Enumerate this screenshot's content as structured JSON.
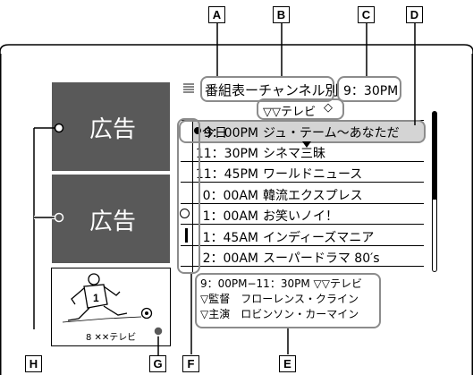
{
  "callouts": {
    "a": "A",
    "b": "B",
    "c": "C",
    "d": "D",
    "e": "E",
    "f": "F",
    "g": "G",
    "h": "H"
  },
  "header": {
    "title": "番組表ーチャンネル別",
    "time": "9：30PM",
    "channel": "▽▽テレビ",
    "channel_arrow": "◇"
  },
  "ads": {
    "top": "広告",
    "middle": "広告"
  },
  "thumbnail": {
    "channel_label": "8 ✕✕テレビ"
  },
  "listings": [
    {
      "prefix": "今日",
      "time": "9：00PM",
      "title": "ジュ・テーム〜あなただ",
      "icon": "",
      "selected": true
    },
    {
      "prefix": "",
      "time": "11：30PM",
      "title": "シネマ三昧",
      "icon": "",
      "selected": false
    },
    {
      "prefix": "",
      "time": "11：45PM",
      "title": "ワールドニュース",
      "icon": "",
      "selected": false
    },
    {
      "prefix": "",
      "time": "0：00AM",
      "title": "韓流エクスプレス",
      "icon": "",
      "selected": false
    },
    {
      "prefix": "",
      "time": "1：00AM",
      "title": "お笑いノイ！",
      "icon": "timer-icon",
      "selected": false
    },
    {
      "prefix": "",
      "time": "1：45AM",
      "title": "インディーズマニア",
      "icon": "bar-icon",
      "selected": false
    },
    {
      "prefix": "",
      "time": "2：00AM",
      "title": "スーパードラマ 80′s",
      "icon": "",
      "selected": false
    }
  ],
  "info": {
    "line1": "9：00PM−11：30PM ▽▽テレビ",
    "line2": "▽監督　フローレンス・クライン",
    "line3": "▽主演　ロビンソン・カーマイン"
  }
}
